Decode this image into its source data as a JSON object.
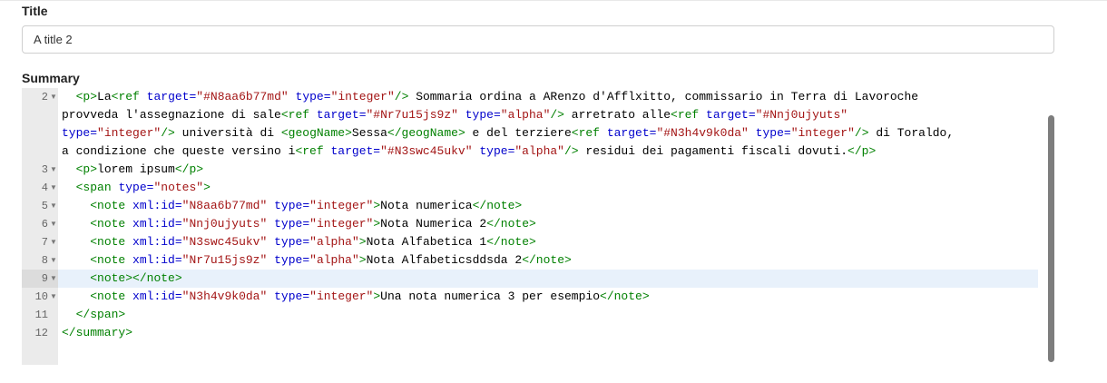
{
  "title_field": {
    "label": "Title",
    "value": "A title 2"
  },
  "summary_field": {
    "label": "Summary",
    "line_numbers": [
      "2",
      "3",
      "4",
      "5",
      "6",
      "7",
      "8",
      "9",
      "10",
      "11",
      "12"
    ],
    "active_line": "9",
    "code_lines": [
      "  <p>La<ref target=\"#N8aa6b77md\" type=\"integer\"/> Sommaria ordina a ARenzo d'Afflxitto, commissario in Terra di Lavoroche",
      "provveda l'assegnazione di sale<ref target=\"#Nr7u15js9z\" type=\"alpha\"/> arretrato alle<ref target=\"#Nnj0ujyuts\"",
      "type=\"integer\"/> università di <geogName>Sessa</geogName> e del terziere<ref target=\"#N3h4v9k0da\" type=\"integer\"/> di Toraldo,",
      "a condizione che queste versino i<ref target=\"#N3swc45ukv\" type=\"alpha\"/> residui dei pagamenti fiscali dovuti.</p>",
      "  <p>lorem ipsum</p>",
      "  <span type=\"notes\">",
      "    <note xml:id=\"N8aa6b77md\" type=\"integer\">Nota numerica</note>",
      "    <note xml:id=\"Nnj0ujyuts\" type=\"integer\">Nota Numerica 2</note>",
      "    <note xml:id=\"N3swc45ukv\" type=\"alpha\">Nota Alfabetica 1</note>",
      "    <note xml:id=\"Nr7u15js9z\" type=\"alpha\">Nota Alfabeticsddsda 2</note>",
      "    <note></note>",
      "    <note xml:id=\"N3h4v9k0da\" type=\"integer\">Una nota numerica 3 per esempio</note>",
      "  </span>",
      "</summary>"
    ]
  },
  "colors": {
    "tag": "#008000",
    "attribute": "#0000cc",
    "value": "#a31515",
    "active_line": "#e8f1fb",
    "gutter": "#ebebeb"
  }
}
